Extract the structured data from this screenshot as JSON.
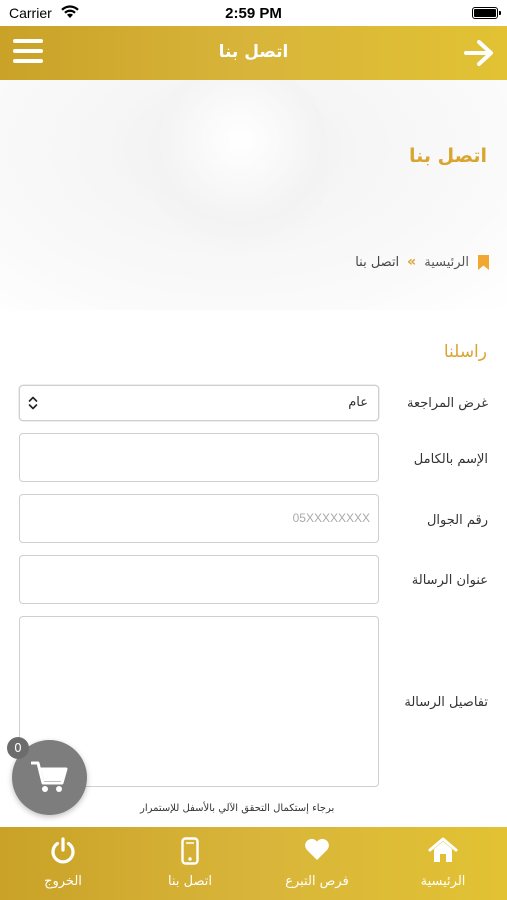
{
  "status_bar": {
    "carrier": "Carrier",
    "time": "2:59 PM"
  },
  "header": {
    "title": "اتصل بنا"
  },
  "hero": {
    "title": "اتصل بنا",
    "breadcrumb": {
      "home": "الرئيسية",
      "separator": "»",
      "current": "اتصل بنا"
    }
  },
  "form": {
    "heading": "راسلنا",
    "purpose": {
      "label": "غرض المراجعة",
      "selected": "عام"
    },
    "full_name": {
      "label": "الإسم بالكامل",
      "value": ""
    },
    "mobile": {
      "label": "رقم الجوال",
      "placeholder": "05XXXXXXXX"
    },
    "subject": {
      "label": "عنوان الرسالة",
      "value": ""
    },
    "details": {
      "label": "تفاصيل الرسالة",
      "value": ""
    },
    "captcha_note": "برجاء إستكمال التحقق الآلي بالأسفل للإستمرار"
  },
  "cart": {
    "count": "0"
  },
  "tabbar": {
    "items": [
      {
        "label": "الرئيسية",
        "icon": "home-icon"
      },
      {
        "label": "فرص التبرع",
        "icon": "heart-icon"
      },
      {
        "label": "اتصل بنا",
        "icon": "mobile-icon"
      },
      {
        "label": "الخروج",
        "icon": "power-icon"
      }
    ]
  },
  "colors": {
    "brand_gold": "#d8b53a",
    "accent_orange": "#d9a531"
  }
}
